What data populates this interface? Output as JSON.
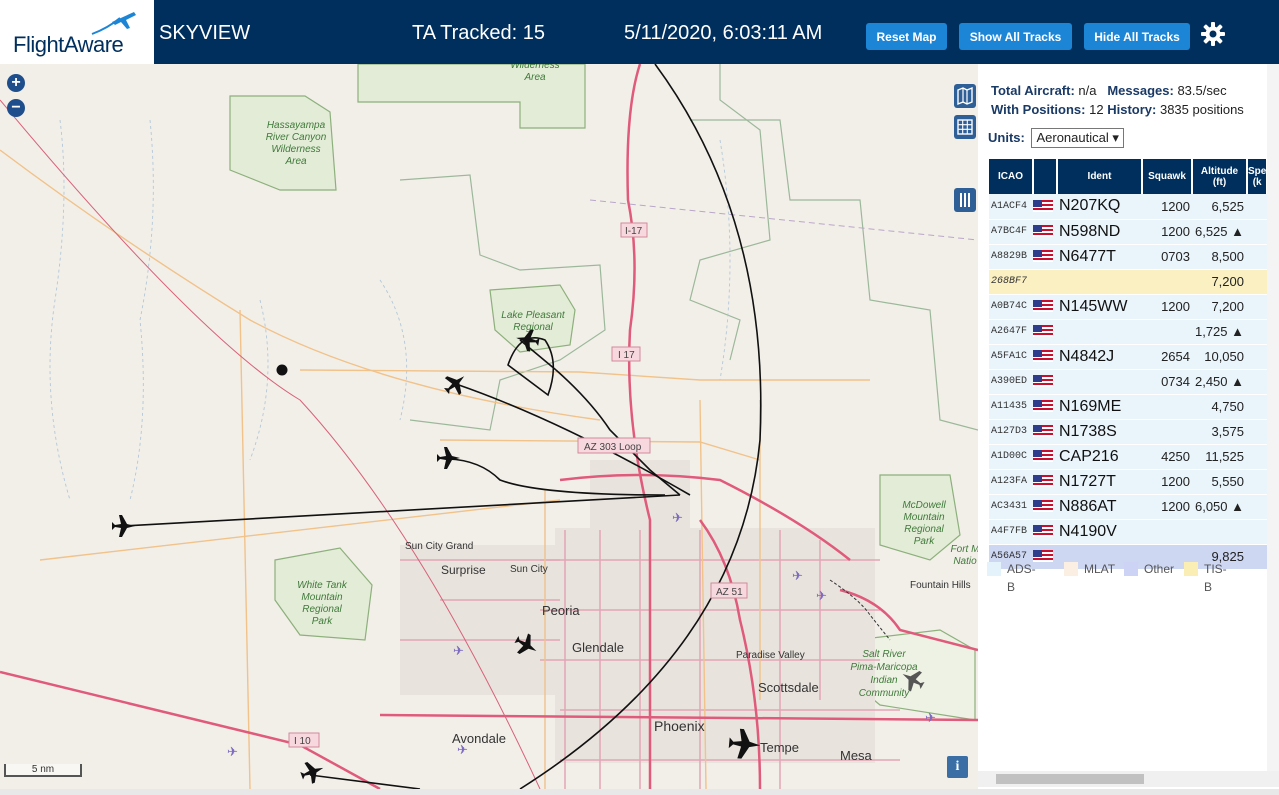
{
  "header": {
    "logo_text": "FlightAware",
    "app_name": "SKYVIEW",
    "tracked": "TA Tracked: 15",
    "datetime": "5/11/2020, 6:03:11 AM",
    "buttons": {
      "reset": "Reset Map",
      "show": "Show All Tracks",
      "hide": "Hide All Tracks"
    },
    "settings_icon": "gear-icon"
  },
  "map": {
    "zoom_in": "+",
    "zoom_out": "−",
    "scale_label": "5 nm",
    "info_label": "i",
    "labels": {
      "wilderness": "Wilderness Area",
      "hassayampa": [
        "Hassayampa",
        "River Canyon",
        "Wilderness",
        "Area"
      ],
      "lake_pleasant": [
        "Lake Pleasant",
        "Regional"
      ],
      "i17_top": "I-17",
      "i17": "I 17",
      "loop303": "AZ 303 Loop",
      "mcdowell": [
        "McDowell",
        "Mountain",
        "Regional",
        "Park"
      ],
      "fort": [
        "Fort M",
        "Natio"
      ],
      "fountain_hills": "Fountain Hills",
      "sun_city_grand": "Sun City Grand",
      "surprise": "Surprise",
      "sun_city": "Sun City",
      "white_tank": [
        "White Tank",
        "Mountain",
        "Regional",
        "Park"
      ],
      "peoria": "Peoria",
      "az51": "AZ 51",
      "glendale": "Glendale",
      "paradise_valley": "Paradise Valley",
      "scottsdale": "Scottsdale",
      "salt_river": [
        "Salt River",
        "Pima-Maricopa",
        "Indian",
        "Community"
      ],
      "i10": "I 10",
      "avondale": "Avondale",
      "phoenix": "Phoenix",
      "tempe": "Tempe",
      "mesa": "Mesa"
    }
  },
  "panel": {
    "stats": {
      "total_label": "Total Aircraft:",
      "total_value": "n/a",
      "messages_label": "Messages:",
      "messages_value": "83.5/sec",
      "positions_label": "With Positions:",
      "positions_value": "12",
      "history_label": "History:",
      "history_value": "3835 positions"
    },
    "units_label": "Units:",
    "units_value": "Aeronautical ▾",
    "columns": [
      "ICAO",
      "",
      "Ident",
      "Squawk",
      "Altitude (ft)",
      "Spe (k"
    ],
    "rows": [
      {
        "icao": "A1ACF4",
        "flag": true,
        "ident": "N207KQ",
        "squawk": "1200",
        "alt": "6,525",
        "kind": "adsb"
      },
      {
        "icao": "A7BC4F",
        "flag": true,
        "ident": "N598ND",
        "squawk": "1200",
        "alt": "6,525 ▲",
        "kind": "adsb"
      },
      {
        "icao": "A8829B",
        "flag": true,
        "ident": "N6477T",
        "squawk": "0703",
        "alt": "8,500",
        "kind": "adsb"
      },
      {
        "icao": "268BF7",
        "flag": false,
        "ident": "",
        "squawk": "",
        "alt": "7,200",
        "kind": "tisb"
      },
      {
        "icao": "A0B74C",
        "flag": true,
        "ident": "N145WW",
        "squawk": "1200",
        "alt": "7,200",
        "kind": "adsb"
      },
      {
        "icao": "A2647F",
        "flag": true,
        "ident": "",
        "squawk": "",
        "alt": "1,725 ▲",
        "kind": "adsb"
      },
      {
        "icao": "A5FA1C",
        "flag": true,
        "ident": "N4842J",
        "squawk": "2654",
        "alt": "10,050",
        "kind": "adsb"
      },
      {
        "icao": "A390ED",
        "flag": true,
        "ident": "",
        "squawk": "0734",
        "alt": "2,450 ▲",
        "kind": "adsb"
      },
      {
        "icao": "A11435",
        "flag": true,
        "ident": "N169ME",
        "squawk": "",
        "alt": "4,750",
        "kind": "adsb"
      },
      {
        "icao": "A127D3",
        "flag": true,
        "ident": "N1738S",
        "squawk": "",
        "alt": "3,575",
        "kind": "adsb"
      },
      {
        "icao": "A1D00C",
        "flag": true,
        "ident": "CAP216",
        "squawk": "4250",
        "alt": "11,525",
        "kind": "adsb"
      },
      {
        "icao": "A123FA",
        "flag": true,
        "ident": "N1727T",
        "squawk": "1200",
        "alt": "5,550",
        "kind": "adsb"
      },
      {
        "icao": "AC3431",
        "flag": true,
        "ident": "N886AT",
        "squawk": "1200",
        "alt": "6,050 ▲",
        "kind": "adsb"
      },
      {
        "icao": "A4F7FB",
        "flag": true,
        "ident": "N4190V",
        "squawk": "",
        "alt": "",
        "kind": "adsb"
      },
      {
        "icao": "A56A57",
        "flag": true,
        "ident": "",
        "squawk": "",
        "alt": "9,825",
        "kind": "selected"
      }
    ],
    "legend": [
      {
        "label": "ADS-B",
        "color": "#e4f2fb"
      },
      {
        "label": "MLAT",
        "color": "#fbeee2"
      },
      {
        "label": "Other",
        "color": "#cdd3f5"
      },
      {
        "label": "TIS-B",
        "color": "#fbeeb4"
      }
    ]
  },
  "colors": {
    "header_bg": "#002f5d",
    "button_bg": "#1d85d6",
    "row_adsb": "#e9f4fb",
    "row_tisb": "#fbf0c2",
    "row_selected": "#cdd7f2"
  }
}
